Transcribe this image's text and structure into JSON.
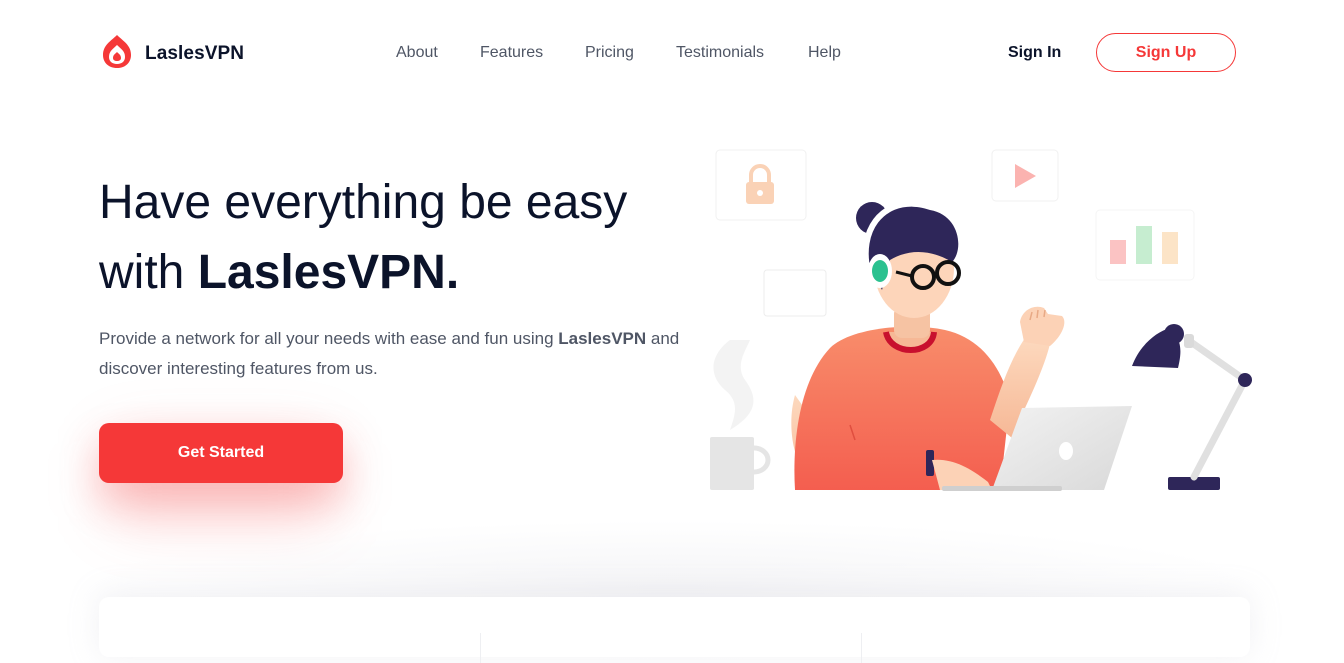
{
  "brand": {
    "name": "LaslesVPN",
    "accent": "#F53838",
    "dark": "#0B132A",
    "muted": "#4F5665"
  },
  "nav": {
    "items": [
      {
        "label": "About"
      },
      {
        "label": "Features"
      },
      {
        "label": "Pricing"
      },
      {
        "label": "Testimonials"
      },
      {
        "label": "Help"
      }
    ],
    "sign_in": "Sign In",
    "sign_up": "Sign Up"
  },
  "hero": {
    "title_line1": "Have everything be easy",
    "title_prefix": "with ",
    "title_brand": "LaslesVPN.",
    "desc_part1": "Provide a network for all your needs with ease and fun using ",
    "desc_brand": "LaslesVPN",
    "desc_part2": " and discover interesting features from us.",
    "cta": "Get Started"
  },
  "illustration": {
    "icons": [
      "lock-icon",
      "play-icon",
      "bar-chart-icon"
    ],
    "colors": {
      "shirt": "#F7735B",
      "hair": "#2E2659",
      "lamp": "#2E2659",
      "skin": "#FBCBAA"
    }
  }
}
